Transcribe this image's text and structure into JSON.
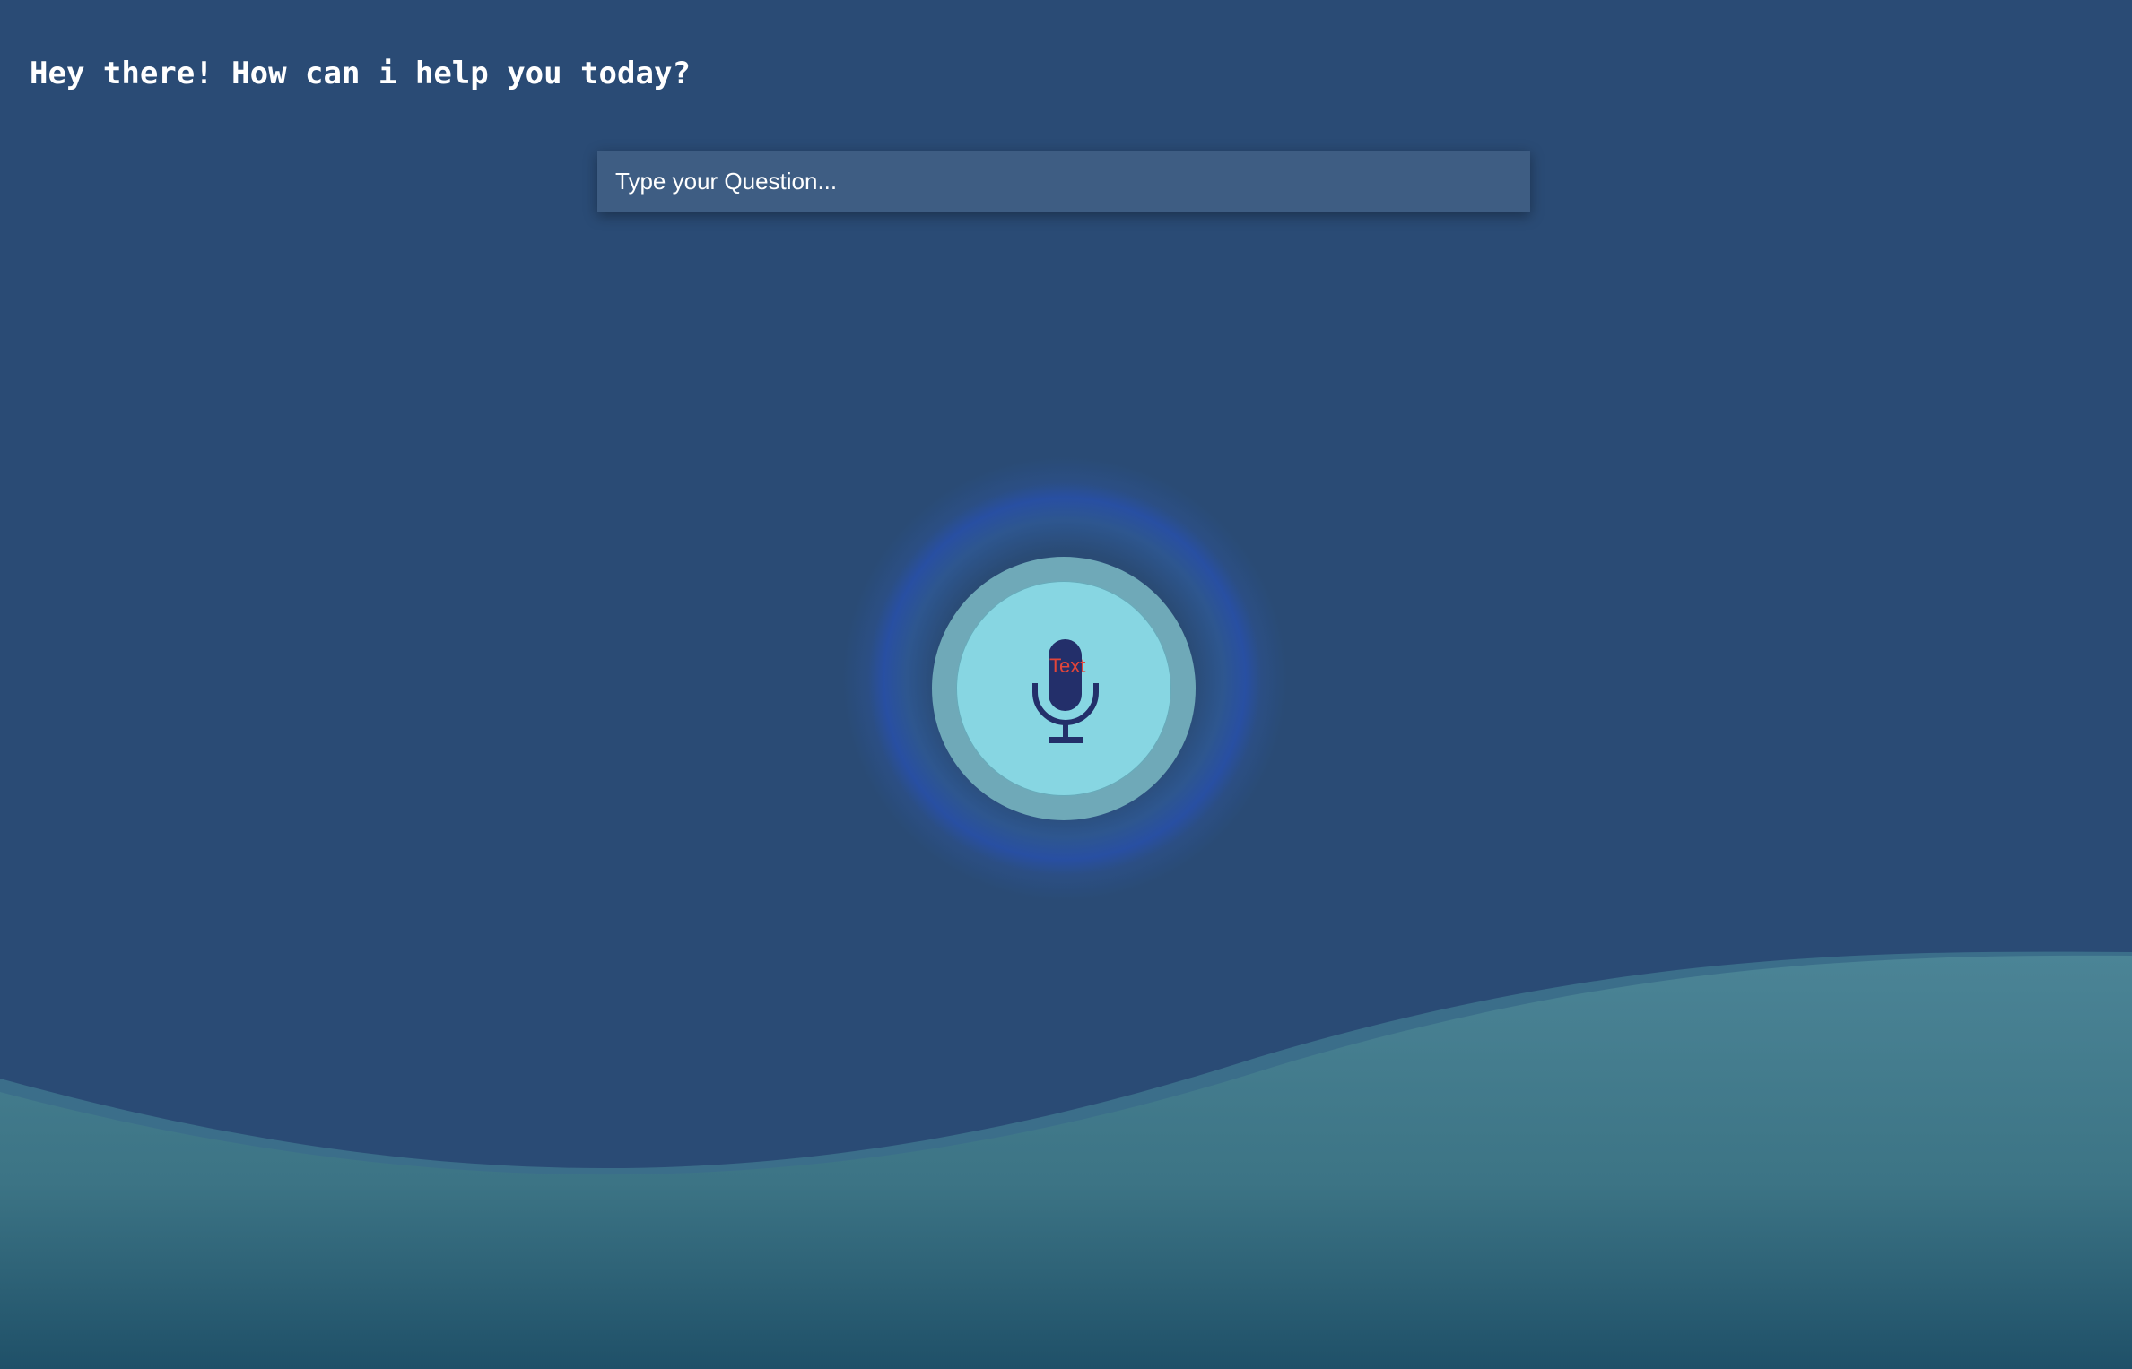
{
  "header": {
    "greeting": "Hey there! How can i help you today?"
  },
  "search": {
    "placeholder": "Type your Question..."
  },
  "mic": {
    "icon": "microphone-icon",
    "label": "Text"
  },
  "colors": {
    "background": "#2a4b75",
    "input_background": "#3e5d83",
    "mic_ring": "#6fa9b8",
    "mic_core": "#87d6e2",
    "mic_icon": "#232f6a",
    "label_text": "#e2453a",
    "wave_top": "#4b8496",
    "wave_bottom": "#1f5068"
  }
}
